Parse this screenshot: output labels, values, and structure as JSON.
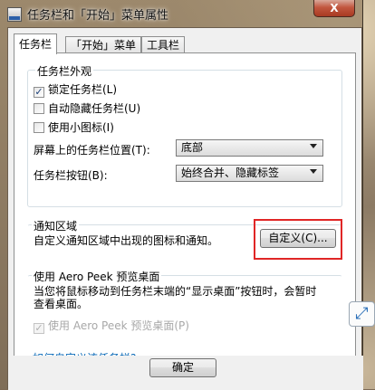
{
  "window": {
    "title": "任务栏和「开始」菜单属性",
    "close_label": "X"
  },
  "tabs": [
    {
      "label": "任务栏"
    },
    {
      "label": "「开始」菜单"
    },
    {
      "label": "工具栏"
    }
  ],
  "appearance": {
    "title": "任务栏外观",
    "lock_taskbar": {
      "label": "锁定任务栏(L)",
      "checked": true
    },
    "auto_hide": {
      "label": "自动隐藏任务栏(U)",
      "checked": false
    },
    "small_icons": {
      "label": "使用小图标(I)",
      "checked": false
    },
    "location_label": "屏幕上的任务栏位置(T):",
    "location_value": "底部",
    "buttons_label": "任务栏按钮(B):",
    "buttons_value": "始终合并、隐藏标签"
  },
  "notification": {
    "title": "通知区域",
    "description": "自定义通知区域中出现的图标和通知。",
    "customize_button": "自定义(C)..."
  },
  "aero_peek": {
    "title": "使用 Aero Peek 预览桌面",
    "description_line1": "当您将鼠标移动到任务栏末端的“显示桌面”按钮时，会暂时",
    "description_line2": "查看桌面。",
    "checkbox_label": "使用 Aero Peek 预览桌面(P)",
    "checked": true,
    "disabled": true
  },
  "help_link": "如何自定义该任务栏?",
  "ok_button": "确定"
}
